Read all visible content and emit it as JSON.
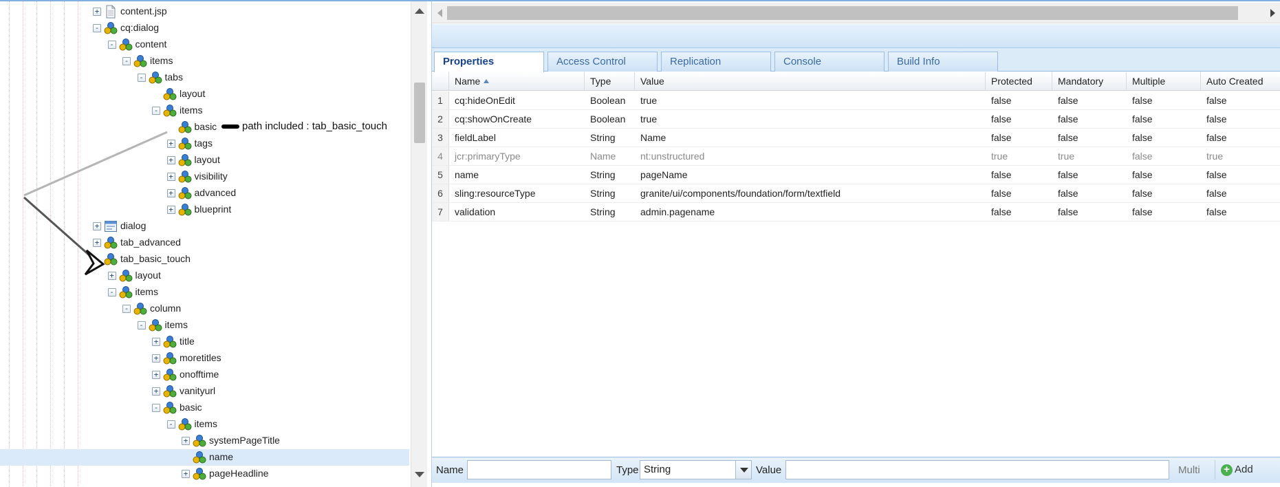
{
  "tree": {
    "rows": [
      {
        "label": "content.jsp",
        "exp": "+",
        "icon": "file"
      },
      {
        "label": "cq:dialog",
        "exp": "-",
        "icon": "node"
      },
      {
        "label": "content",
        "exp": "-",
        "icon": "node"
      },
      {
        "label": "items",
        "exp": "-",
        "icon": "node"
      },
      {
        "label": "tabs",
        "exp": "-",
        "icon": "node"
      },
      {
        "label": "layout",
        "exp": "",
        "icon": "node"
      },
      {
        "label": "items",
        "exp": "-",
        "icon": "node"
      },
      {
        "label": "basic",
        "exp": "",
        "icon": "node"
      },
      {
        "label": "tags",
        "exp": "+",
        "icon": "node"
      },
      {
        "label": "layout",
        "exp": "+",
        "icon": "node"
      },
      {
        "label": "visibility",
        "exp": "+",
        "icon": "node"
      },
      {
        "label": "advanced",
        "exp": "+",
        "icon": "node"
      },
      {
        "label": "blueprint",
        "exp": "+",
        "icon": "node"
      },
      {
        "label": "dialog",
        "exp": "+",
        "icon": "dialog"
      },
      {
        "label": "tab_advanced",
        "exp": "+",
        "icon": "node"
      },
      {
        "label": "tab_basic_touch",
        "exp": "",
        "icon": "node"
      },
      {
        "label": "layout",
        "exp": "+",
        "icon": "node"
      },
      {
        "label": "items",
        "exp": "-",
        "icon": "node"
      },
      {
        "label": "column",
        "exp": "-",
        "icon": "node"
      },
      {
        "label": "items",
        "exp": "-",
        "icon": "node"
      },
      {
        "label": "title",
        "exp": "+",
        "icon": "node"
      },
      {
        "label": "moretitles",
        "exp": "+",
        "icon": "node"
      },
      {
        "label": "onofftime",
        "exp": "+",
        "icon": "node"
      },
      {
        "label": "vanityurl",
        "exp": "+",
        "icon": "node"
      },
      {
        "label": "basic",
        "exp": "-",
        "icon": "node"
      },
      {
        "label": "items",
        "exp": "-",
        "icon": "node"
      },
      {
        "label": "systemPageTitle",
        "exp": "+",
        "icon": "node"
      },
      {
        "label": "name",
        "exp": "",
        "icon": "node",
        "selected": true
      },
      {
        "label": "pageHeadline",
        "exp": "+",
        "icon": "node"
      }
    ],
    "annotation": "path included : tab_basic_touch"
  },
  "tabs": [
    "Properties",
    "Access Control",
    "Replication",
    "Console",
    "Build Info"
  ],
  "active_tab": "Properties",
  "grid": {
    "columns": [
      "",
      "Name",
      "Type",
      "Value",
      "Protected",
      "Mandatory",
      "Multiple",
      "Auto Created"
    ],
    "sort_column": "Name",
    "rows": [
      {
        "num": "1",
        "name": "cq:hideOnEdit",
        "type": "Boolean",
        "value": "true",
        "protected": "false",
        "mandatory": "false",
        "multiple": "false",
        "auto": "false"
      },
      {
        "num": "2",
        "name": "cq:showOnCreate",
        "type": "Boolean",
        "value": "true",
        "protected": "false",
        "mandatory": "false",
        "multiple": "false",
        "auto": "false"
      },
      {
        "num": "3",
        "name": "fieldLabel",
        "type": "String",
        "value": "Name",
        "protected": "false",
        "mandatory": "false",
        "multiple": "false",
        "auto": "false"
      },
      {
        "num": "4",
        "name": "jcr:primaryType",
        "type": "Name",
        "value": "nt:unstructured",
        "protected": "true",
        "mandatory": "true",
        "multiple": "false",
        "auto": "true",
        "dim": true
      },
      {
        "num": "5",
        "name": "name",
        "type": "String",
        "value": "pageName",
        "protected": "false",
        "mandatory": "false",
        "multiple": "false",
        "auto": "false"
      },
      {
        "num": "6",
        "name": "sling:resourceType",
        "type": "String",
        "value": "granite/ui/components/foundation/form/textfield",
        "protected": "false",
        "mandatory": "false",
        "multiple": "false",
        "auto": "false"
      },
      {
        "num": "7",
        "name": "validation",
        "type": "String",
        "value": "admin.pagename",
        "protected": "false",
        "mandatory": "false",
        "multiple": "false",
        "auto": "false"
      }
    ]
  },
  "bottom": {
    "name_label": "Name",
    "name_value": "",
    "type_label": "Type",
    "type_value": "String",
    "value_label": "Value",
    "value_value": "",
    "multi_label": "Multi",
    "add_label": "Add"
  }
}
